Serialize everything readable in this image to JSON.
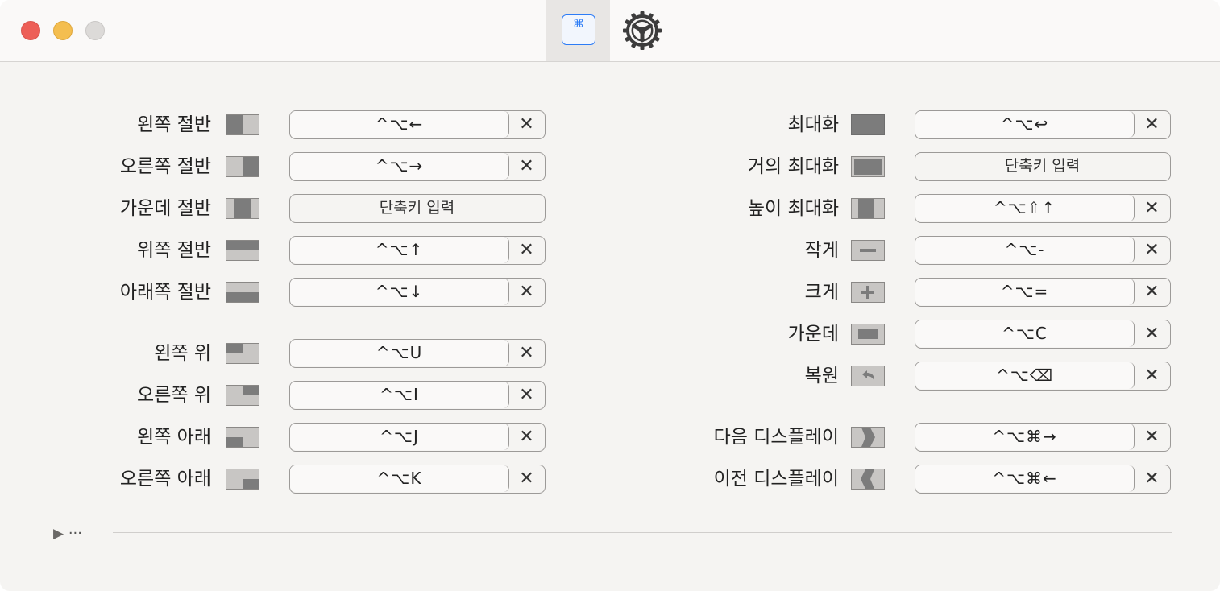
{
  "toolbar": {
    "shortcuts_tab_glyph": "⌘",
    "shortcuts_tab_icon": "keyboard-command-icon",
    "preferences_tab_icon": "gear-icon"
  },
  "colors": {
    "accent": "#2d7cf6",
    "close": "#ed5f57",
    "minimize": "#f4be4f",
    "zoom_inactive": "#dcdad8",
    "icon_dark": "#7c7c7c",
    "icon_light": "#c8c6c4"
  },
  "clear_label": "✕",
  "placeholder": "단축키 입력",
  "left_actions": [
    {
      "label": "왼쪽 절반",
      "shortcut": "^⌥←",
      "icon": "left-half-icon"
    },
    {
      "label": "오른쪽 절반",
      "shortcut": "^⌥→",
      "icon": "right-half-icon"
    },
    {
      "label": "가운데 절반",
      "shortcut": "",
      "icon": "center-half-icon"
    },
    {
      "label": "위쪽 절반",
      "shortcut": "^⌥↑",
      "icon": "top-half-icon"
    },
    {
      "label": "아래쪽 절반",
      "shortcut": "^⌥↓",
      "icon": "bottom-half-icon"
    },
    {
      "label": "왼쪽 위",
      "shortcut": "^⌥U",
      "icon": "top-left-icon"
    },
    {
      "label": "오른쪽 위",
      "shortcut": "^⌥I",
      "icon": "top-right-icon"
    },
    {
      "label": "왼쪽 아래",
      "shortcut": "^⌥J",
      "icon": "bottom-left-icon"
    },
    {
      "label": "오른쪽 아래",
      "shortcut": "^⌥K",
      "icon": "bottom-right-icon"
    }
  ],
  "right_actions": [
    {
      "label": "최대화",
      "shortcut": "^⌥↩",
      "icon": "maximize-icon"
    },
    {
      "label": "거의 최대화",
      "shortcut": "",
      "icon": "almost-maximize-icon"
    },
    {
      "label": "높이 최대화",
      "shortcut": "^⌥⇧↑",
      "icon": "maximize-height-icon"
    },
    {
      "label": "작게",
      "shortcut": "^⌥-",
      "icon": "smaller-icon"
    },
    {
      "label": "크게",
      "shortcut": "^⌥=",
      "icon": "larger-icon"
    },
    {
      "label": "가운데",
      "shortcut": "^⌥C",
      "icon": "center-icon"
    },
    {
      "label": "복원",
      "shortcut": "^⌥⌫",
      "icon": "restore-icon"
    },
    {
      "label": "다음 디스플레이",
      "shortcut": "^⌥⌘→",
      "icon": "next-display-icon"
    },
    {
      "label": "이전 디스플레이",
      "shortcut": "^⌥⌘←",
      "icon": "previous-display-icon"
    }
  ],
  "footer": {
    "disclosure_glyph": "▶",
    "more_label": "···"
  }
}
